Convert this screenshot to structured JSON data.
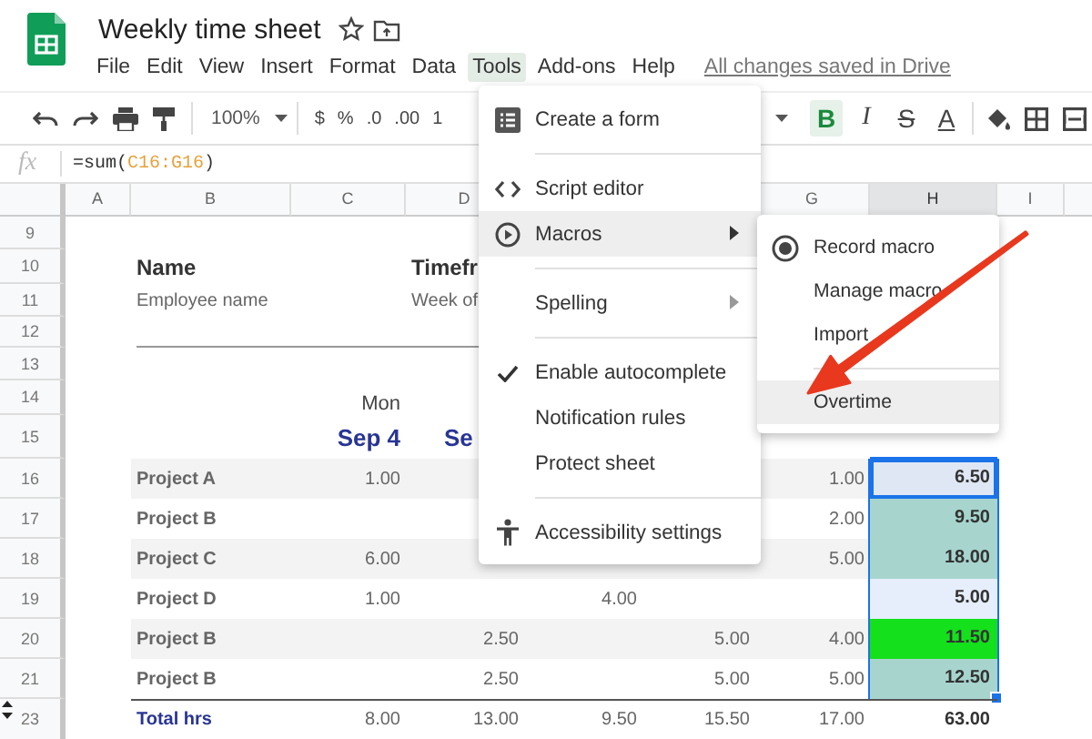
{
  "app": {
    "title": "Weekly time sheet",
    "save_status": "All changes saved in Drive"
  },
  "menu_bar": [
    {
      "label": "File",
      "selected": false
    },
    {
      "label": "Edit",
      "selected": false
    },
    {
      "label": "View",
      "selected": false
    },
    {
      "label": "Insert",
      "selected": false
    },
    {
      "label": "Format",
      "selected": false
    },
    {
      "label": "Data",
      "selected": false
    },
    {
      "label": "Tools",
      "selected": true
    },
    {
      "label": "Add-ons",
      "selected": false
    },
    {
      "label": "Help",
      "selected": false
    }
  ],
  "toolbar": {
    "zoom": "100%",
    "format_buttons": [
      "$",
      "%",
      ".0",
      ".00",
      "1"
    ],
    "style_buttons": [
      {
        "label": "B",
        "on": true
      },
      {
        "label": "I",
        "on": false
      },
      {
        "label": "S",
        "on": false
      },
      {
        "label": "A",
        "on": false
      }
    ]
  },
  "formula_bar": {
    "fx": "fx",
    "formula": [
      {
        "text": "=sum(",
        "kind": "plain"
      },
      {
        "text": "C16:G16",
        "kind": "range"
      },
      {
        "text": ")",
        "kind": "plain"
      }
    ]
  },
  "sheet": {
    "column_headers": {
      "column_a": {
        "label": "A",
        "selected": false
      },
      "column_b": {
        "label": "B",
        "selected": false
      },
      "column_c": {
        "label": "C",
        "selected": false
      },
      "column_d": {
        "label": "D",
        "selected": false
      },
      "column_g": {
        "label": "G",
        "selected": false
      },
      "column_h": {
        "label": "H",
        "selected": true
      },
      "column_i": {
        "label": "I",
        "selected": false
      }
    },
    "rows": [
      {
        "number": "9",
        "kind": "blank"
      },
      {
        "number": "10",
        "kind": "title",
        "column_b": "Name",
        "column_d": "Timefr"
      },
      {
        "number": "11",
        "kind": "subtitle",
        "column_b": "Employee name",
        "column_d": "Week of"
      },
      {
        "number": "12",
        "kind": "divider"
      },
      {
        "number": "13",
        "kind": "blank"
      },
      {
        "number": "14",
        "kind": "weekday",
        "column_c": "Mon"
      },
      {
        "number": "15",
        "kind": "date",
        "column_c": "Sep 4",
        "column_d": "Se"
      },
      {
        "number": "16",
        "kind": "project",
        "shaded": true,
        "column_b": "Project A",
        "column_c": "1.00",
        "column_g": "1.00",
        "total": {
          "value": "6.50",
          "color": "#dfe7f5",
          "selected": true,
          "active": true
        }
      },
      {
        "number": "17",
        "kind": "project",
        "shaded": false,
        "column_b": "Project B",
        "column_g": "2.00",
        "total": {
          "value": "9.50",
          "color": "#a7d5ce",
          "selected": true,
          "active": false
        }
      },
      {
        "number": "18",
        "kind": "project",
        "shaded": true,
        "column_b": "Project C",
        "column_c": "6.00",
        "column_g": "5.00",
        "total": {
          "value": "18.00",
          "color": "#a7d5ce",
          "selected": true,
          "active": false
        }
      },
      {
        "number": "19",
        "kind": "project",
        "shaded": false,
        "column_b": "Project D",
        "column_c": "1.00",
        "column_e": "4.00",
        "total": {
          "value": "5.00",
          "color": "#e6eefb",
          "selected": true,
          "active": false
        }
      },
      {
        "number": "20",
        "kind": "project",
        "shaded": true,
        "column_b": "Project B",
        "column_d": "2.50",
        "column_f": "5.00",
        "column_g": "4.00",
        "total": {
          "value": "11.50",
          "color": "#14e01c",
          "selected": true,
          "active": false
        }
      },
      {
        "number": "21",
        "kind": "project",
        "shaded": false,
        "column_b": "Project B",
        "column_d": "2.50",
        "column_f": "5.00",
        "column_g": "5.00",
        "total": {
          "value": "12.50",
          "color": "#a7d5ce",
          "selected": true,
          "active": false
        }
      },
      {
        "number": "23",
        "kind": "total",
        "hidden_rows_above": true,
        "column_b": "Total hrs",
        "column_c": "8.00",
        "column_d": "13.00",
        "column_e": "9.50",
        "column_f": "15.50",
        "column_g": "17.00",
        "total": {
          "value": "63.00",
          "selected": false,
          "active": false
        }
      }
    ]
  },
  "tools_menu": {
    "groups": [
      [
        {
          "label": "Create a form",
          "checked": false,
          "submenu": false,
          "selected": false
        }
      ],
      [
        {
          "label": "Script editor",
          "checked": false,
          "submenu": false,
          "selected": false
        },
        {
          "label": "Macros",
          "checked": false,
          "submenu": true,
          "selected": true
        }
      ],
      [
        {
          "label": "Spelling",
          "checked": false,
          "submenu": true,
          "selected": false
        }
      ],
      [
        {
          "label": "Enable autocomplete",
          "checked": true,
          "submenu": false,
          "selected": false
        },
        {
          "label": "Notification rules",
          "checked": false,
          "submenu": false,
          "selected": false
        },
        {
          "label": "Protect sheet",
          "checked": false,
          "submenu": false,
          "selected": false
        }
      ],
      [
        {
          "label": "Accessibility settings",
          "checked": false,
          "submenu": false,
          "selected": false
        }
      ]
    ]
  },
  "macros_submenu": {
    "groups": [
      [
        {
          "label": "Record macro",
          "selected": false
        },
        {
          "label": "Manage macro",
          "selected": false
        },
        {
          "label": "Import",
          "selected": false
        }
      ],
      [
        {
          "label": "Overtime",
          "selected": true
        }
      ]
    ]
  }
}
